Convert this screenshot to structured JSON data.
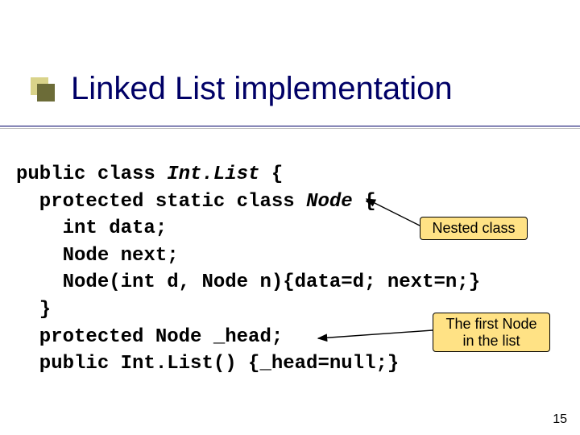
{
  "title": "Linked List implementation",
  "code": {
    "l1_a": "public class ",
    "l1_b": "Int.List",
    "l1_c": " {",
    "l2_a": "  protected static class ",
    "l2_b": "Node",
    "l2_c": " {",
    "l3": "    int data;",
    "l4": "    Node next;",
    "l5": "    Node(int d, Node n){data=d; next=n;}",
    "l6": "  }",
    "l7": "  protected Node _head;",
    "l8": "  public Int.List() {_head=null;}"
  },
  "callout1": "Nested class",
  "callout2": "The first Node\nin the list",
  "pagenum": "15"
}
